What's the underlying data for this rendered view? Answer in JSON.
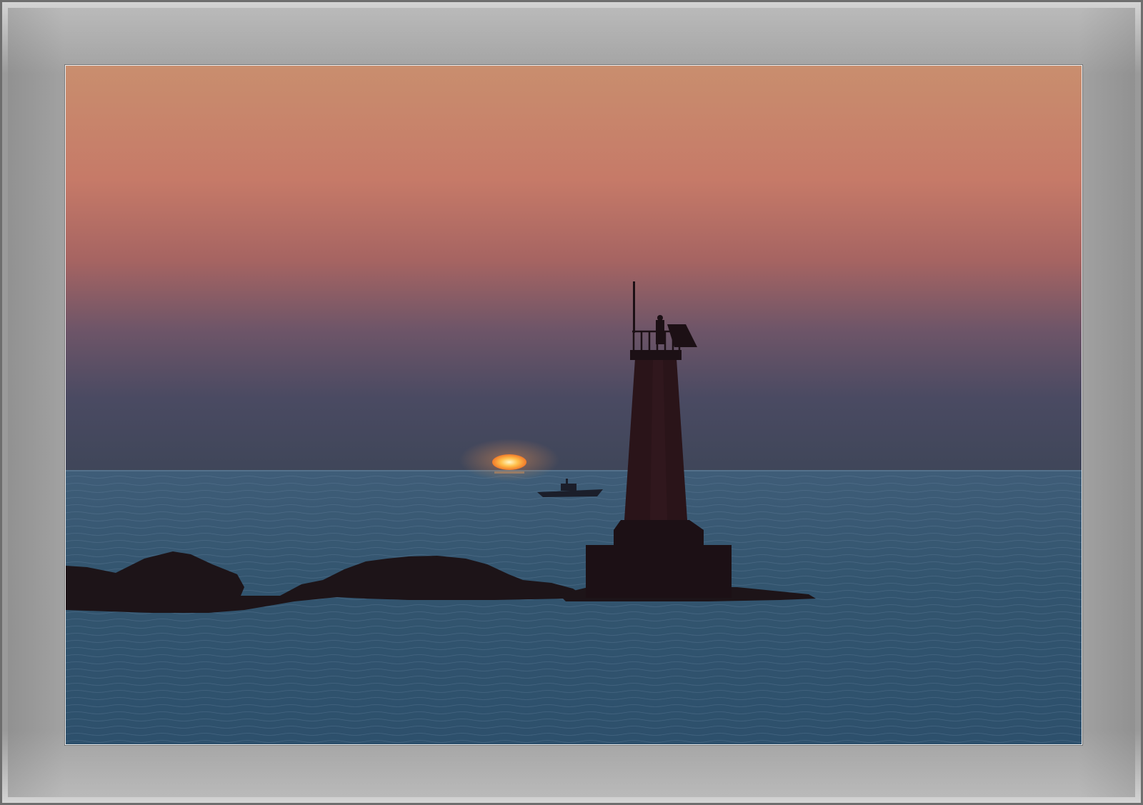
{
  "scene": {
    "subject": "lighthouse",
    "colors": {
      "sky_top": "#c98e6e",
      "sky_mid": "#c2756a",
      "sky_violet": "#7a5a6e",
      "sky_low": "#3e4660",
      "sea_far": "#3b5873",
      "sea_near": "#2c4e6c",
      "sun": "#ffb24a",
      "silhouette": "#1a1014",
      "frame": "#9a9a9a"
    }
  }
}
